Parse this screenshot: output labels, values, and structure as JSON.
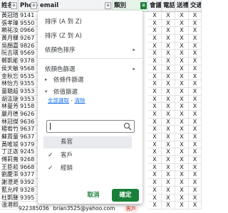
{
  "headers": {
    "name": "姓名",
    "phone": "Phone",
    "email": "email",
    "category": "類別",
    "c1": "會議",
    "c2": "電話",
    "c3": "送禮",
    "c4": "交通"
  },
  "names": [
    "黃冠瑄",
    "張孝瑋",
    "賴祐汝",
    "黃月驊",
    "吳顏嘉",
    "阮吉瑀",
    "鄭凱能",
    "侯天敏",
    "金秋忘",
    "林怡方",
    "童聴超",
    "胡汯瑞",
    "林曼芳",
    "嚴月德",
    "林冠傑",
    "楊宥竹",
    "蘇貫童",
    "黃唯竣",
    "丁正迦",
    "傅莉寬",
    "王臣菘",
    "劉慶潔",
    "謝澄澔",
    "藍允梓",
    "杜凱騨",
    "溫港照"
  ],
  "phones": [
    "9141",
    "9550",
    "0966",
    "9267",
    "9826",
    "9569",
    "9378",
    "9568",
    "9535",
    "9355",
    "9353",
    "9353",
    "9158",
    "9626",
    "9636",
    "9637",
    "9637",
    "9379",
    "9245",
    "9268",
    "9668",
    "9377",
    "9392",
    "9328",
    "9395",
    "9223"
  ],
  "last_row_full": {
    "phone": "922385036",
    "email": "brian3525@yahoo.com",
    "tag": "客戶"
  },
  "cells": {
    "row_marks": [
      [
        "X",
        "X",
        "X",
        "X"
      ],
      [
        "X",
        "X",
        "X",
        "X"
      ],
      [
        "X",
        "X",
        "X",
        "X"
      ],
      [
        "X",
        "X",
        "X",
        "X"
      ],
      [
        "X",
        "X",
        "X",
        "X"
      ],
      [
        "X",
        "X",
        "X",
        "X"
      ],
      [
        "X",
        "X",
        "X",
        "X"
      ],
      [
        "X",
        "X",
        "X",
        "X"
      ],
      [
        "X",
        "X",
        "X",
        "X"
      ],
      [
        "X",
        "X",
        "X",
        "X"
      ],
      [
        "X",
        "X",
        "X",
        "X"
      ],
      [
        "X",
        "X",
        "X",
        "X"
      ],
      [
        "X",
        "X",
        "X",
        "X"
      ],
      [
        "X",
        "X",
        "X",
        "X"
      ],
      [
        "X",
        "X",
        "X",
        "X"
      ],
      [
        "X",
        "X",
        "X",
        "X"
      ],
      [
        "X",
        "X",
        "X",
        "X"
      ],
      [
        "X",
        "X",
        "X",
        "X"
      ],
      [
        "X",
        "X",
        "X",
        "X"
      ],
      [
        "X",
        "X",
        "X",
        "X"
      ],
      [
        "X",
        "X",
        "X",
        "X"
      ],
      [
        "X",
        "X",
        "X",
        "X"
      ],
      [
        "X",
        "X",
        "X",
        "X"
      ],
      [
        "X",
        "X",
        "X",
        "X"
      ],
      [
        "X",
        "X",
        "X",
        "X"
      ],
      [
        "X",
        "X",
        "X",
        "X"
      ]
    ]
  },
  "menu": {
    "sort_az": "排序 (A 到 Z)",
    "sort_za": "排序 (Z 到 A)",
    "sort_by_color": "依顏色排序",
    "filter_by_color": "依顏色篩選",
    "filter_by_condition": "依條件篩選",
    "filter_by_values": "依值篩選",
    "select_all": "全部選取",
    "clear": "清除",
    "search_placeholder": "",
    "options": [
      {
        "label": "長官",
        "checked": false
      },
      {
        "label": "客戶",
        "checked": true
      },
      {
        "label": "經銷",
        "checked": true
      }
    ],
    "cancel": "取消",
    "ok": "確定"
  },
  "colors": {
    "accent": "#188038",
    "link": "#1a73e8",
    "header_bg": "#f1f3f4"
  }
}
